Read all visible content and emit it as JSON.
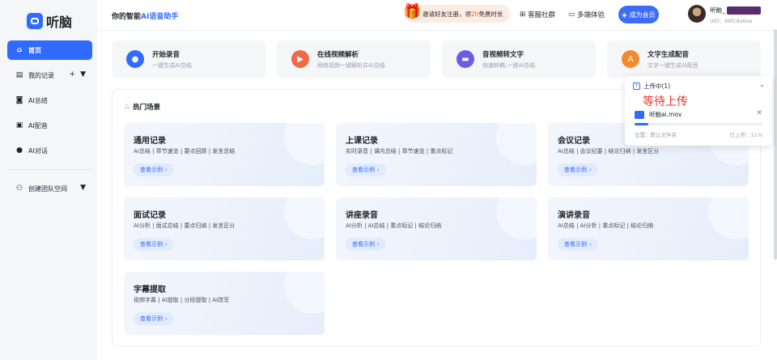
{
  "app": {
    "logo_text": "听脑"
  },
  "sidebar": {
    "items": [
      {
        "label": "首页",
        "icon": "home-icon"
      },
      {
        "label": "我的记录",
        "icon": "document-icon"
      },
      {
        "label": "AI总结",
        "icon": "robot-icon"
      },
      {
        "label": "AI配音",
        "icon": "dub-icon"
      },
      {
        "label": "AI对话",
        "icon": "chat-icon"
      }
    ],
    "records_add": "+",
    "records_caret": "▼",
    "team": {
      "label": "创建团队空间",
      "icon": "team-icon",
      "caret": "▼"
    }
  },
  "header": {
    "subtitle_prefix": "你的智能",
    "subtitle_accent": "AI语音助手",
    "promo": {
      "text_a": "邀请好友注册，领",
      "highlight": "2h",
      "text_b": "免费时长"
    },
    "community": "客服社群",
    "multi_device": "多端体验",
    "vip": "成为会员",
    "user": {
      "name": "听脑_",
      "uid": "UID：86fc8a6ee"
    }
  },
  "quick_actions": [
    {
      "title": "开始录音",
      "desc": "一键生成AI总结",
      "color": "#2f6bff",
      "icon": "microphone-icon"
    },
    {
      "title": "在线视频解析",
      "desc": "网络视频一键解析并AI总结",
      "color": "#f06a4a",
      "icon": "video-icon"
    },
    {
      "title": "音视频转文字",
      "desc": "快速转稿,一键AI总结",
      "color": "#6b5ce7",
      "icon": "transcribe-icon"
    },
    {
      "title": "文字生成配音",
      "desc": "文字一键生成AI配音",
      "color": "#f58a2a",
      "icon": "text-voice-icon"
    }
  ],
  "hot_scenes": {
    "title": "热门场景",
    "button_label": "查看示例",
    "cards": [
      {
        "title": "通用记录",
        "desc": "AI总结 | 章节速览 | 要点回顾 | 发言总结"
      },
      {
        "title": "上课记录",
        "desc": "实时录音 | 课内总结 | 章节速览 | 重点标记"
      },
      {
        "title": "会议记录",
        "desc": "AI总结 | 会议纪要 | 结论归纳 | 发言区分"
      },
      {
        "title": "面试记录",
        "desc": "AI分析 | 面试总结 | 要点归纳 | 发言区分"
      },
      {
        "title": "讲座录音",
        "desc": "AI分析 | AI总结 | 重点标记 | 结论归纳"
      },
      {
        "title": "演讲录音",
        "desc": "AI总结 | AI分析 | 重点标记 | 结论归纳"
      },
      {
        "title": "字幕提取",
        "desc": "视频字幕 | AI提取 | 分段提取 | AI改写"
      }
    ]
  },
  "upload": {
    "header": "上传中(1)",
    "waiting": "等待上传",
    "filename": "听脑ai.mov",
    "location": "位置：默认文件夹",
    "progress_text": "已上传：11%",
    "progress": 0.11
  }
}
